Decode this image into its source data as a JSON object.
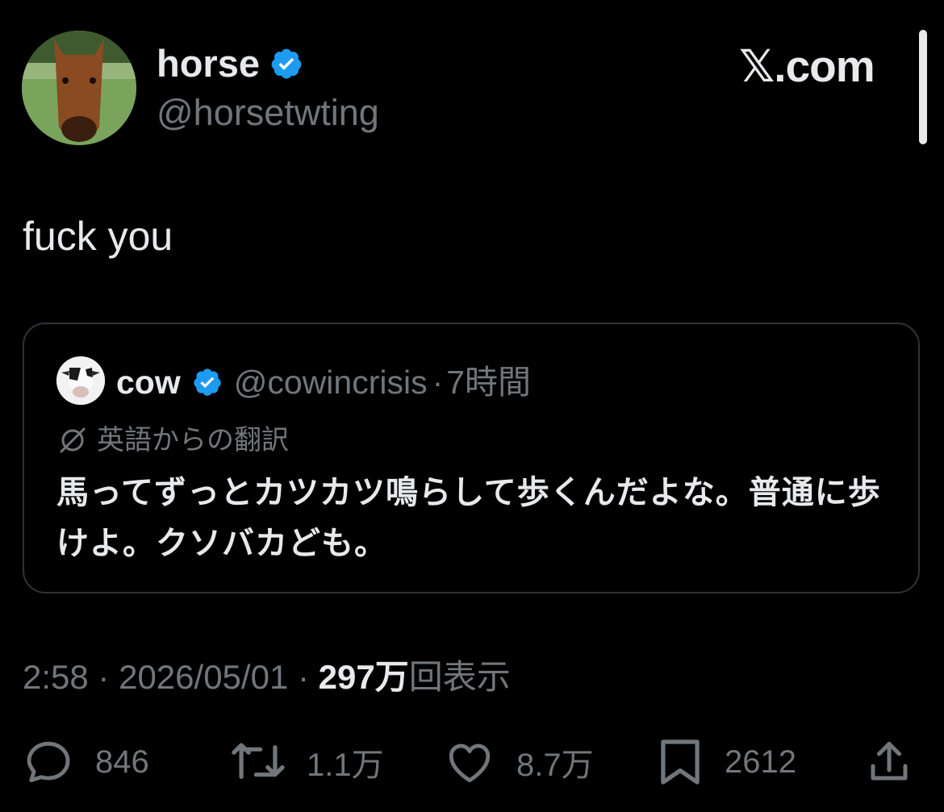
{
  "author": {
    "name": "horse",
    "handle": "@horsetwting",
    "verified_color": "#1d9bf0"
  },
  "brand": "𝕏.com",
  "tweet": {
    "text": "fuck you"
  },
  "quote": {
    "name": "cow",
    "handle": "@cowincrisis",
    "separator": "·",
    "time": "7時間",
    "translation_label": "英語からの翻訳",
    "text": "馬ってずっとカツカツ鳴らして歩くんだよな。普通に歩けよ。クソバカども。"
  },
  "meta": {
    "time": "2:58",
    "date": "2026/05/01",
    "separator": "·",
    "views_count": "297万",
    "views_label": "回表示"
  },
  "actions": {
    "replies": "846",
    "retweets": "1.1万",
    "likes": "8.7万",
    "bookmarks": "2612"
  },
  "icons": [
    "verified-badge-icon",
    "translate-icon",
    "reply-icon",
    "retweet-icon",
    "like-icon",
    "bookmark-icon",
    "share-icon"
  ]
}
